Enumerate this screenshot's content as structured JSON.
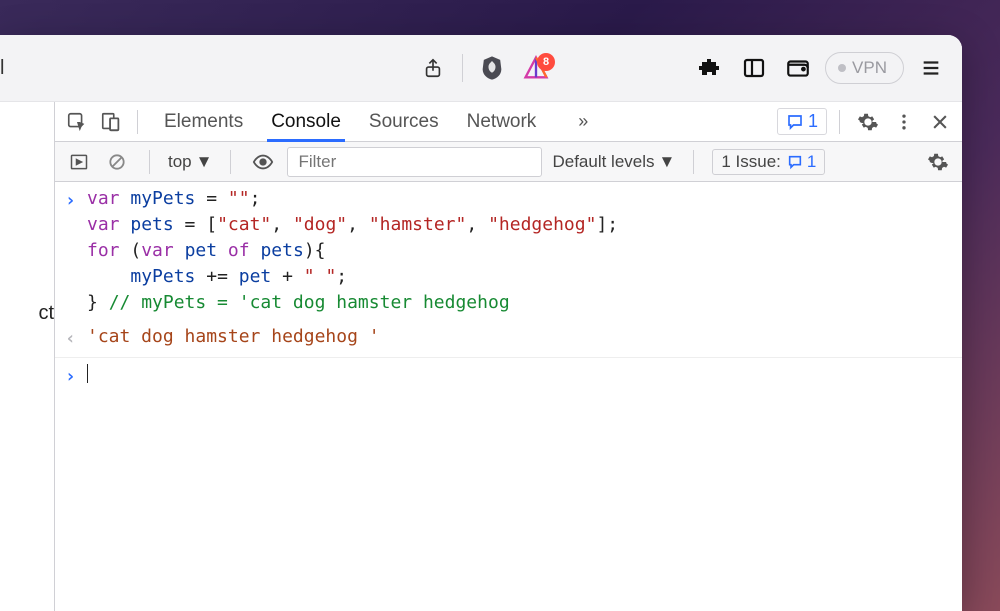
{
  "chevron_expand": "⌄",
  "url_tail_text": "l",
  "toolbar": {
    "share_label": "Share",
    "shield_label": "Shields",
    "triangle_label": "Brave Rewards",
    "triangle_badge": "8",
    "puzzle_label": "Extensions",
    "sidebar_label": "Sidebar",
    "wallet_label": "Wallet",
    "vpn_label": "VPN",
    "menu_label": "Menu"
  },
  "page": {
    "visible_text": "ct"
  },
  "devtools": {
    "tabs": [
      "Elements",
      "Console",
      "Sources",
      "Network"
    ],
    "active_tab_index": 1,
    "more_tabs_glyph": "»",
    "msg_icon_count": "1",
    "gear_label": "Settings",
    "kebab_label": "More",
    "close_label": "Close"
  },
  "console_toolbar": {
    "play_label": "Execute",
    "clear_label": "Clear console",
    "context_label": "top",
    "eye_label": "Show messages",
    "filter_placeholder": "Filter",
    "levels_label": "Default levels",
    "issue_prefix": "1 Issue:",
    "issue_count": "1",
    "settings_label": "Console settings"
  },
  "console": {
    "input": {
      "line1": {
        "kw1": "var",
        "ident": "myPets",
        "rest": " = ",
        "str": "\"\"",
        "end": ";"
      },
      "line2": {
        "kw1": "var",
        "ident": "pets",
        "rest": " = [",
        "strs": [
          "\"cat\"",
          "\"dog\"",
          "\"hamster\"",
          "\"hedgehog\""
        ],
        "end": "];"
      },
      "line3": {
        "kw1": "for",
        "rest1": " (",
        "kw2": "var",
        "ident": "pet",
        "kw3": "of",
        "ident2": "pets",
        "rest2": "){"
      },
      "line4": {
        "indent": "    ",
        "ident": "myPets",
        "rest": " += ",
        "ident2": "pet",
        "rest2": " + ",
        "str": "\" \"",
        "end": ";"
      },
      "line5": {
        "brace": "} ",
        "comment": "// myPets = 'cat dog hamster hedgehog"
      }
    },
    "output": "'cat dog hamster hedgehog '"
  }
}
